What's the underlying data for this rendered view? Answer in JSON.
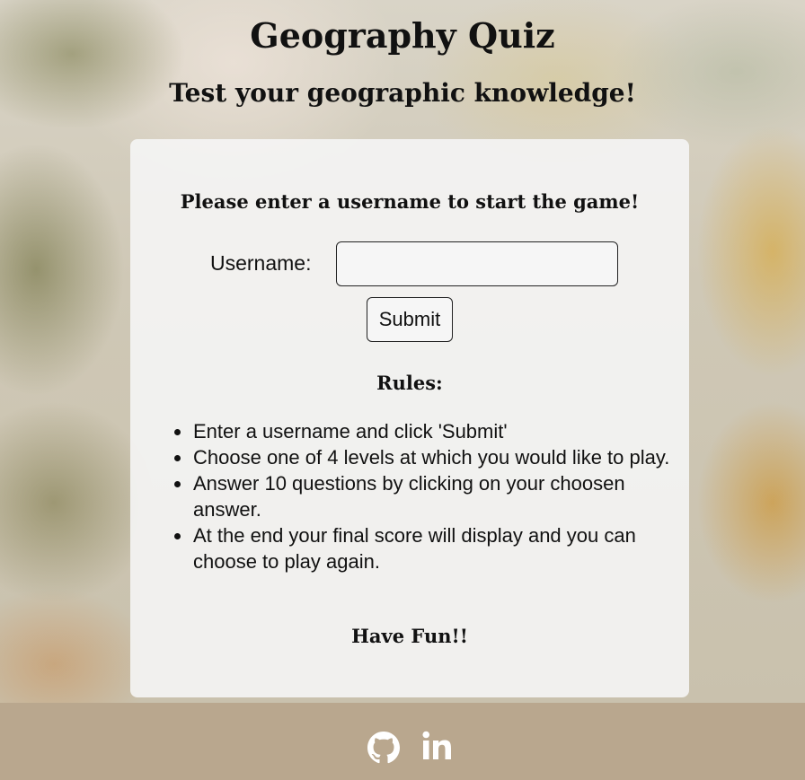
{
  "header": {
    "title": "Geography Quiz",
    "subtitle": "Test your geographic knowledge!"
  },
  "form": {
    "prompt": "Please enter a username to start the game!",
    "username_label": "Username:",
    "username_value": "",
    "submit_label": "Submit"
  },
  "rules": {
    "title": "Rules:",
    "items": [
      "Enter a username and click 'Submit'",
      "Choose one of 4 levels at which you would like to play.",
      "Answer 10 questions by clicking on your choosen answer.",
      "At the end your final score will display and you can choose to play again."
    ],
    "closing": "Have Fun!!"
  },
  "footer": {
    "icons": [
      "github-icon",
      "linkedin-icon"
    ],
    "background_color": "#b9a78e"
  }
}
